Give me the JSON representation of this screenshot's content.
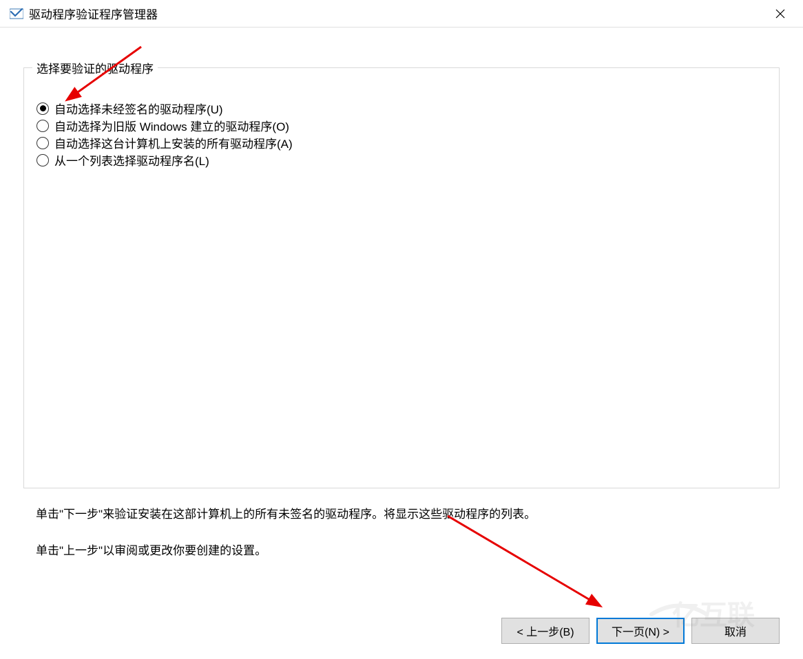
{
  "titlebar": {
    "title": "驱动程序验证程序管理器"
  },
  "fieldset": {
    "legend": "选择要验证的驱动程序"
  },
  "options": {
    "opt1": {
      "label": "自动选择未经签名的驱动程序(U)",
      "selected": true
    },
    "opt2": {
      "label": "自动选择为旧版 Windows 建立的驱动程序(O)",
      "selected": false
    },
    "opt3": {
      "label": "自动选择这台计算机上安装的所有驱动程序(A)",
      "selected": false
    },
    "opt4": {
      "label": "从一个列表选择驱动程序名(L)",
      "selected": false
    }
  },
  "hints": {
    "line1": "单击\"下一步\"来验证安装在这部计算机上的所有未签名的驱动程序。将显示这些驱动程序的列表。",
    "line2": "单击\"上一步\"以审阅或更改你要创建的设置。"
  },
  "buttons": {
    "back": "< 上一步(B)",
    "next": "下一页(N) >",
    "cancel": "取消"
  }
}
